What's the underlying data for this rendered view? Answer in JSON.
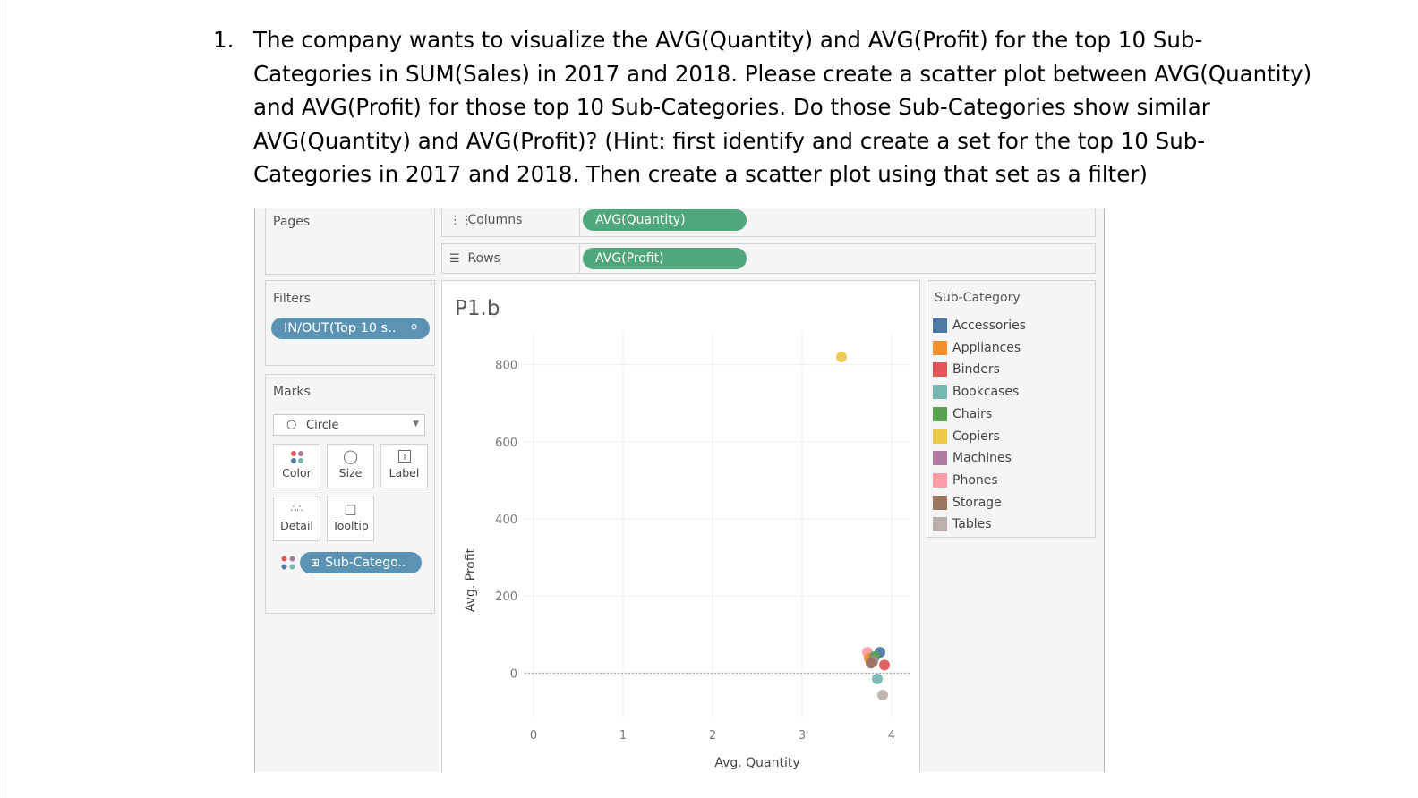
{
  "question": {
    "number": "1.",
    "lines": [
      "The company wants to visualize the AVG(Quantity) and AVG(Profit) for the top 10 Sub-",
      "Categories in SUM(Sales) in 2017 and 2018. Please create a scatter plot between AVG(Quantity)",
      "and AVG(Profit) for those top 10 Sub-Categories. Do those Sub-Categories show similar",
      "AVG(Quantity) and AVG(Profit)? (Hint: first identify and create a set for the top 10 Sub-",
      "Categories in 2017 and 2018. Then create a scatter plot using that set as a filter)"
    ]
  },
  "pages": {
    "title": "Pages"
  },
  "shelves": {
    "columns_label": "Columns",
    "columns_pill": "AVG(Quantity)",
    "rows_label": "Rows",
    "rows_pill": "AVG(Profit)"
  },
  "filters": {
    "title": "Filters",
    "pill": "IN/OUT(Top 10 s.."
  },
  "marks": {
    "title": "Marks",
    "type": "Circle",
    "buttons": {
      "color": "Color",
      "size": "Size",
      "label": "Label",
      "detail": "Detail",
      "tooltip": "Tooltip"
    },
    "color_pill": "Sub-Catego.."
  },
  "legend": {
    "title": "Sub-Category",
    "items": [
      {
        "name": "Accessories",
        "color": "#4e79a7"
      },
      {
        "name": "Appliances",
        "color": "#f28e2b"
      },
      {
        "name": "Binders",
        "color": "#e15759"
      },
      {
        "name": "Bookcases",
        "color": "#76b7b2"
      },
      {
        "name": "Chairs",
        "color": "#59a14f"
      },
      {
        "name": "Copiers",
        "color": "#edc948"
      },
      {
        "name": "Machines",
        "color": "#b07aa1"
      },
      {
        "name": "Phones",
        "color": "#ff9da7"
      },
      {
        "name": "Storage",
        "color": "#9c755f"
      },
      {
        "name": "Tables",
        "color": "#bab0ac"
      }
    ]
  },
  "chart_data": {
    "type": "scatter",
    "title": "P1.b",
    "xlabel": "Avg. Quantity",
    "ylabel": "Avg. Profit",
    "xlim": [
      -0.1,
      4.2
    ],
    "ylim": [
      -115,
      885
    ],
    "x_ticks": [
      0,
      1,
      2,
      3,
      4
    ],
    "y_ticks": [
      0,
      200,
      400,
      600,
      800
    ],
    "zero_line": true,
    "grid": true,
    "points": [
      {
        "name": "Copiers",
        "x": 3.44,
        "y": 820,
        "color": "#edc948"
      },
      {
        "name": "Phones",
        "x": 3.73,
        "y": 54,
        "color": "#ff9da7"
      },
      {
        "name": "Accessories",
        "x": 3.87,
        "y": 54,
        "color": "#4e79a7"
      },
      {
        "name": "Appliances",
        "x": 3.75,
        "y": 38,
        "color": "#f28e2b"
      },
      {
        "name": "Chairs",
        "x": 3.81,
        "y": 43,
        "color": "#59a14f"
      },
      {
        "name": "Machines",
        "x": 3.79,
        "y": 30,
        "color": "#b07aa1"
      },
      {
        "name": "Storage",
        "x": 3.77,
        "y": 26,
        "color": "#9c755f"
      },
      {
        "name": "Binders",
        "x": 3.92,
        "y": 21,
        "color": "#e15759"
      },
      {
        "name": "Bookcases",
        "x": 3.84,
        "y": -15,
        "color": "#76b7b2"
      },
      {
        "name": "Tables",
        "x": 3.9,
        "y": -57,
        "color": "#bab0ac"
      }
    ]
  }
}
